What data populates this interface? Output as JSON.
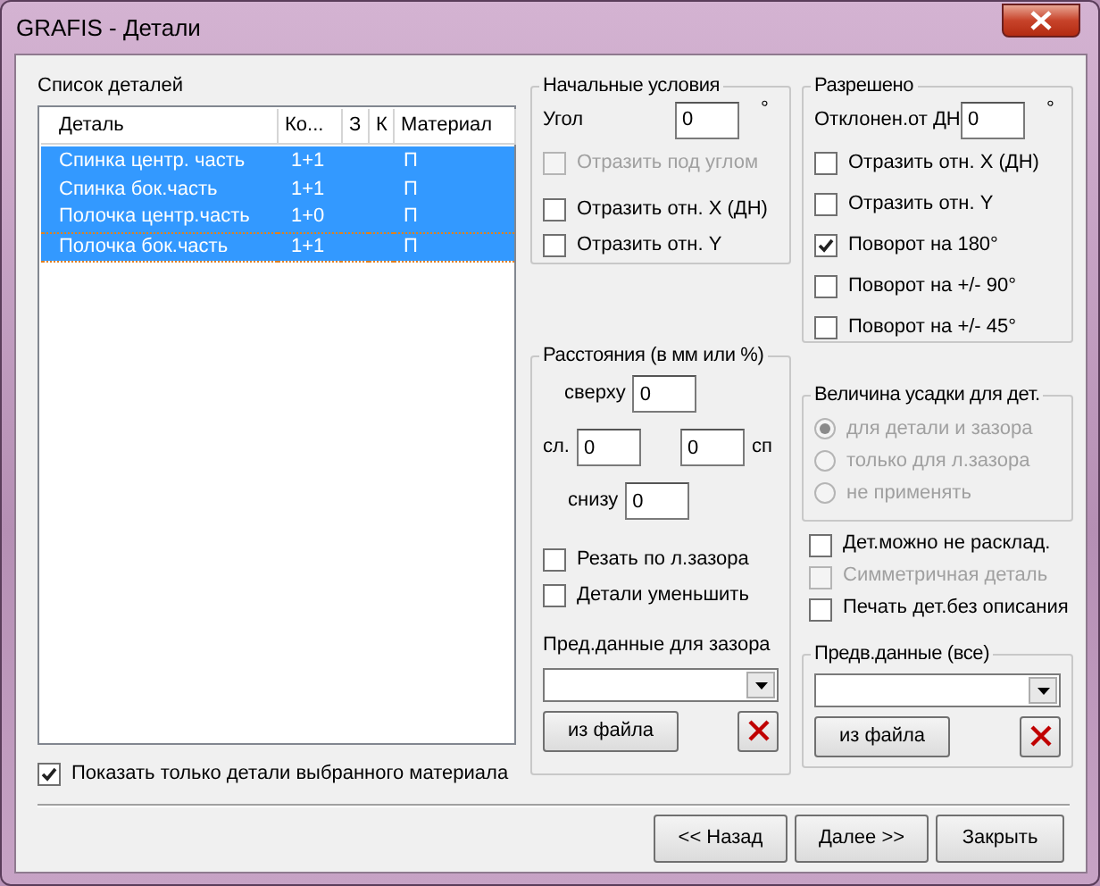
{
  "window": {
    "title": "GRAFIS - Детали"
  },
  "parts_list": {
    "label": "Список деталей",
    "columns": [
      "Деталь",
      "Ко...",
      "З",
      "К",
      "Материал"
    ],
    "rows": [
      {
        "cells": [
          "Спинка центр. часть",
          "1+1",
          "",
          "",
          "П"
        ],
        "selected": true,
        "focused": false
      },
      {
        "cells": [
          "Спинка бок.часть",
          "1+1",
          "",
          "",
          "П"
        ],
        "selected": true,
        "focused": false
      },
      {
        "cells": [
          "Полочка центр.часть",
          "1+0",
          "",
          "",
          "П"
        ],
        "selected": true,
        "focused": false
      },
      {
        "cells": [
          "Полочка бок.часть",
          "1+1",
          "",
          "",
          "П"
        ],
        "selected": true,
        "focused": true
      }
    ]
  },
  "show_only_material": {
    "label": "Показать только детали выбранного материала",
    "checked": true
  },
  "initial_conditions": {
    "title": "Начальные условия",
    "angle": {
      "label": "Угол",
      "value": "0",
      "unit": "°"
    },
    "checkboxes": [
      {
        "label": "Отразить под углом",
        "checked": false,
        "disabled": true
      },
      {
        "label": "Отразить отн. X (ДН)",
        "checked": false,
        "disabled": false
      },
      {
        "label": "Отразить отн. Y",
        "checked": false,
        "disabled": false
      }
    ]
  },
  "allowed": {
    "title": "Разрешено",
    "deviation": {
      "label": "Отклонен.от ДН",
      "value": "0",
      "unit": "°"
    },
    "checkboxes": [
      {
        "label": "Отразить отн. X (ДН)",
        "checked": false,
        "disabled": false
      },
      {
        "label": "Отразить отн. Y",
        "checked": false,
        "disabled": false
      },
      {
        "label": "Поворот на 180°",
        "checked": true,
        "disabled": false
      },
      {
        "label": "Поворот на +/- 90°",
        "checked": false,
        "disabled": false
      },
      {
        "label": "Поворот на +/- 45°",
        "checked": false,
        "disabled": false
      }
    ]
  },
  "distances": {
    "title": "Расстояния (в мм или %)",
    "top": {
      "label": "сверху",
      "value": "0"
    },
    "left": {
      "label": "сл.",
      "value": "0"
    },
    "right": {
      "label": "сп",
      "value": "0"
    },
    "bottom": {
      "label": "снизу",
      "value": "0"
    },
    "checkboxes": [
      {
        "label": "Резать по л.зазора",
        "checked": false,
        "disabled": false
      },
      {
        "label": "Детали уменьшить",
        "checked": false,
        "disabled": false
      }
    ],
    "gap_presets": {
      "label": "Пред.данные для зазора",
      "button": "из файла"
    }
  },
  "shrinkage": {
    "title": "Величина усадки для дет.",
    "disabled": true,
    "options": [
      {
        "label": "для детали и зазора",
        "selected": true
      },
      {
        "label": "только для л.зазора",
        "selected": false
      },
      {
        "label": "не применять",
        "selected": false
      }
    ]
  },
  "extra_checkboxes": [
    {
      "label": "Дет.можно не расклад.",
      "checked": false,
      "disabled": false
    },
    {
      "label": "Симметричная деталь",
      "checked": false,
      "disabled": true
    },
    {
      "label": "Печать дет.без описания",
      "checked": false,
      "disabled": false
    }
  ],
  "all_presets": {
    "title": "Предв.данные (все)",
    "button": "из файла"
  },
  "buttons": [
    "<< Назад",
    "Далее >>",
    "Закрыть"
  ]
}
